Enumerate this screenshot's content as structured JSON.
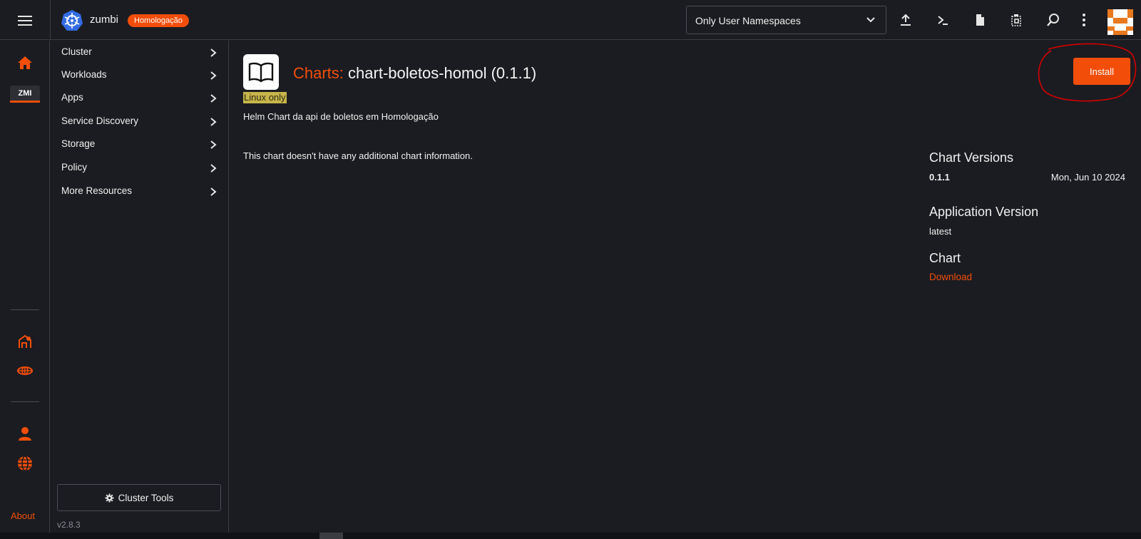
{
  "header": {
    "cluster_name": "zumbi",
    "env_badge": "Homologação",
    "namespace_filter": "Only User Namespaces",
    "icons": [
      "menu-icon",
      "kubernetes-logo",
      "upload-icon",
      "terminal-icon",
      "file-icon",
      "copy-config-icon",
      "search-icon",
      "more-vertical-icon",
      "avatar"
    ]
  },
  "rail": {
    "cluster_short": "ZMI",
    "about": "About",
    "icons": [
      "home-icon",
      "fleet-icon",
      "globe-grid-icon",
      "user-icon",
      "globe-icon"
    ]
  },
  "sidenav": {
    "items": [
      {
        "label": "Cluster"
      },
      {
        "label": "Workloads"
      },
      {
        "label": "Apps"
      },
      {
        "label": "Service Discovery"
      },
      {
        "label": "Storage"
      },
      {
        "label": "Policy"
      },
      {
        "label": "More Resources"
      }
    ],
    "cluster_tools": "Cluster Tools",
    "version": "v2.8.3"
  },
  "main": {
    "title_prefix": "Charts:",
    "title": "chart-boletos-homol (0.1.1)",
    "os_badge": "Linux only",
    "description": "Helm Chart da api de boletos em Homologação",
    "no_info": "This chart doesn't have any additional chart information.",
    "install_label": "Install"
  },
  "side_panel": {
    "versions_heading": "Chart Versions",
    "version": "0.1.1",
    "version_date": "Mon, Jun 10 2024",
    "app_version_heading": "Application Version",
    "app_version": "latest",
    "chart_heading": "Chart",
    "download_label": "Download"
  },
  "colors": {
    "accent": "#f24e0a",
    "background": "#1b1c21",
    "annotation": "#d40000"
  }
}
